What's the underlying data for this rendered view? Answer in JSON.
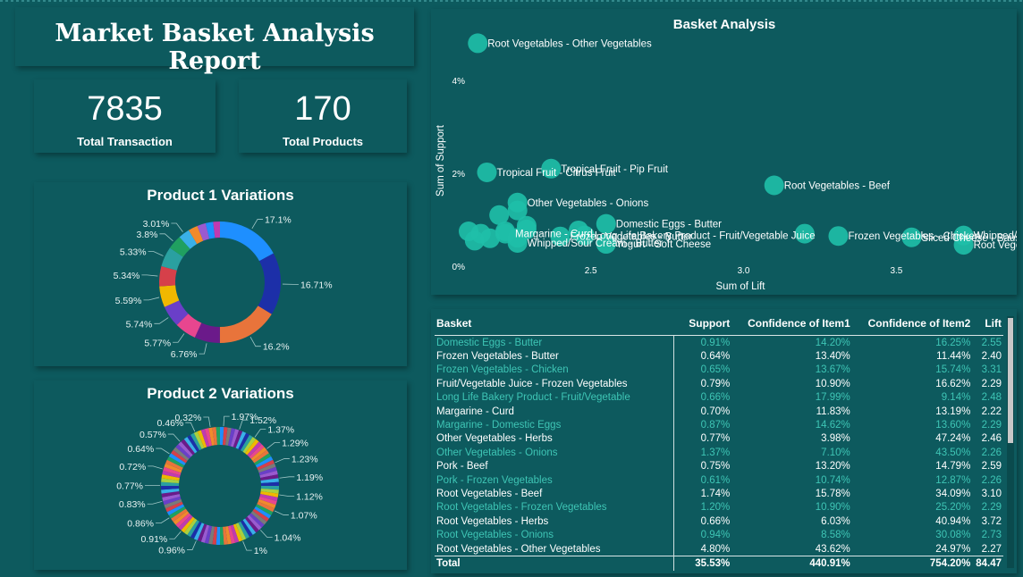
{
  "header": {
    "title": "Market Basket Analysis Report"
  },
  "kpis": {
    "total_transaction": {
      "value": "7835",
      "label": "Total Transaction"
    },
    "total_products": {
      "value": "170",
      "label": "Total Products"
    }
  },
  "donut1": {
    "title": "Product 1 Variations",
    "labels": [
      "17.1%",
      "16.71%",
      "16.2%",
      "6.76%",
      "5.77%",
      "5.74%",
      "5.59%",
      "5.34%",
      "5.33%",
      "3.8%",
      "3.01%"
    ],
    "values": [
      17.1,
      16.71,
      16.2,
      6.76,
      5.77,
      5.74,
      5.59,
      5.34,
      5.33,
      3.8,
      3.01,
      2.5,
      2.3,
      2.0,
      1.8
    ],
    "colors": [
      "#1e8fff",
      "#1c2fa8",
      "#e8743b",
      "#6b1a8a",
      "#e8468f",
      "#6a3fc8",
      "#f0b800",
      "#d6404a",
      "#2aa0a0",
      "#20a060",
      "#3ab0e8",
      "#f08a2c",
      "#9a5ad0",
      "#1e8fff",
      "#c03ab0"
    ]
  },
  "donut2": {
    "title": "Product 2 Variations",
    "labels": [
      "1.97%",
      "1.52%",
      "1.37%",
      "1.29%",
      "1.23%",
      "1.19%",
      "1.12%",
      "1.07%",
      "1.04%",
      "1%",
      "0.96%",
      "0.91%",
      "0.86%",
      "0.83%",
      "0.77%",
      "0.72%",
      "0.64%",
      "0.57%",
      "0.46%",
      "0.32%"
    ],
    "segment_count": 96,
    "palette": [
      "#1e8fff",
      "#1c2fa8",
      "#e8743b",
      "#6b1a8a",
      "#e8468f",
      "#6a3fc8",
      "#f0b800",
      "#d6404a",
      "#2aa0a0",
      "#20a060",
      "#3ab0e8",
      "#f08a2c",
      "#9a5ad0",
      "#c03ab0",
      "#7a7a7a",
      "#a8d040"
    ]
  },
  "chart_data": {
    "type": "scatter",
    "title": "Basket Analysis",
    "xlabel": "Sum of Lift",
    "ylabel": "Sum of Support",
    "xlim": [
      2.1,
      3.85
    ],
    "ylim": [
      0,
      5.0
    ],
    "xticks": [
      "2.5",
      "3.0",
      "3.5"
    ],
    "xtick_values": [
      2.5,
      3.0,
      3.5
    ],
    "yticks": [
      "0%",
      "2%",
      "4%"
    ],
    "ytick_values": [
      0,
      2,
      4
    ],
    "color": "#1fbfa8",
    "points": [
      {
        "x": 2.13,
        "y": 4.8,
        "label": "Root Vegetables - Other Vegetables"
      },
      {
        "x": 2.37,
        "y": 2.1,
        "label": "Tropical Fruit - Pip Fruit"
      },
      {
        "x": 2.16,
        "y": 2.02,
        "label": "Tropical Fruit - Citrus Fruit"
      },
      {
        "x": 2.26,
        "y": 1.37,
        "label": "Other Vegetables - Onions"
      },
      {
        "x": 2.55,
        "y": 0.91,
        "label": "Domestic Eggs - Butter"
      },
      {
        "x": 3.1,
        "y": 1.74,
        "label": "Root Vegetables - Beef"
      },
      {
        "x": 3.72,
        "y": 0.66,
        "label": "Whipped/Sour Cream - Berries"
      },
      {
        "x": 2.22,
        "y": 0.7,
        "label": "Margarine - Curd"
      },
      {
        "x": 2.48,
        "y": 0.66,
        "label": "Long Life Bakery Product - Fruit/Vegetable Juice"
      },
      {
        "x": 3.55,
        "y": 0.62,
        "label": "Sliced Cheese - Sausage"
      },
      {
        "x": 2.26,
        "y": 0.5,
        "label": "Whipped/Sour Cream - Butter"
      },
      {
        "x": 3.72,
        "y": 0.46,
        "label": "Root Vegetables - Herbs"
      },
      {
        "x": 2.4,
        "y": 0.64,
        "label": "Frozen Vegetables - Butter"
      },
      {
        "x": 2.55,
        "y": 0.48,
        "label": "Yogurt - Soft Cheese"
      },
      {
        "x": 3.31,
        "y": 0.65,
        "label": "Frozen Vegetables - Chicken"
      },
      {
        "x": 2.29,
        "y": 0.79,
        "label": ""
      },
      {
        "x": 2.22,
        "y": 0.75,
        "label": ""
      },
      {
        "x": 2.29,
        "y": 0.87,
        "label": ""
      },
      {
        "x": 2.46,
        "y": 0.77,
        "label": ""
      },
      {
        "x": 2.26,
        "y": 1.2,
        "label": ""
      },
      {
        "x": 2.26,
        "y": 0.61,
        "label": ""
      },
      {
        "x": 2.14,
        "y": 0.7,
        "label": ""
      },
      {
        "x": 2.1,
        "y": 0.75,
        "label": ""
      },
      {
        "x": 2.17,
        "y": 0.6,
        "label": ""
      },
      {
        "x": 2.12,
        "y": 0.55,
        "label": ""
      },
      {
        "x": 2.2,
        "y": 1.1,
        "label": ""
      },
      {
        "x": 3.2,
        "y": 0.7,
        "label": ""
      }
    ]
  },
  "table": {
    "columns": [
      "Basket",
      "Support",
      "Confidence of Item1",
      "Confidence of Item2",
      "Lift"
    ],
    "rows": [
      [
        "Domestic Eggs - Butter",
        "0.91%",
        "14.20%",
        "16.25%",
        "2.55"
      ],
      [
        "Frozen Vegetables - Butter",
        "0.64%",
        "13.40%",
        "11.44%",
        "2.40"
      ],
      [
        "Frozen Vegetables - Chicken",
        "0.65%",
        "13.67%",
        "15.74%",
        "3.31"
      ],
      [
        "Fruit/Vegetable Juice - Frozen Vegetables",
        "0.79%",
        "10.90%",
        "16.62%",
        "2.29"
      ],
      [
        "Long Life Bakery Product - Fruit/Vegetable",
        "0.66%",
        "17.99%",
        "9.14%",
        "2.48"
      ],
      [
        "Margarine - Curd",
        "0.70%",
        "11.83%",
        "13.19%",
        "2.22"
      ],
      [
        "Margarine - Domestic Eggs",
        "0.87%",
        "14.62%",
        "13.60%",
        "2.29"
      ],
      [
        "Other Vegetables - Herbs",
        "0.77%",
        "3.98%",
        "47.24%",
        "2.46"
      ],
      [
        "Other Vegetables - Onions",
        "1.37%",
        "7.10%",
        "43.50%",
        "2.26"
      ],
      [
        "Pork - Beef",
        "0.75%",
        "13.20%",
        "14.79%",
        "2.59"
      ],
      [
        "Pork - Frozen Vegetables",
        "0.61%",
        "10.74%",
        "12.87%",
        "2.26"
      ],
      [
        "Root Vegetables - Beef",
        "1.74%",
        "15.78%",
        "34.09%",
        "3.10"
      ],
      [
        "Root Vegetables - Frozen Vegetables",
        "1.20%",
        "10.90%",
        "25.20%",
        "2.29"
      ],
      [
        "Root Vegetables - Herbs",
        "0.66%",
        "6.03%",
        "40.94%",
        "3.72"
      ],
      [
        "Root Vegetables - Onions",
        "0.94%",
        "8.58%",
        "30.08%",
        "2.73"
      ],
      [
        "Root Vegetables - Other Vegetables",
        "4.80%",
        "43.62%",
        "24.97%",
        "2.27"
      ]
    ],
    "total": [
      "Total",
      "35.53%",
      "440.91%",
      "754.20%",
      "84.47"
    ]
  }
}
